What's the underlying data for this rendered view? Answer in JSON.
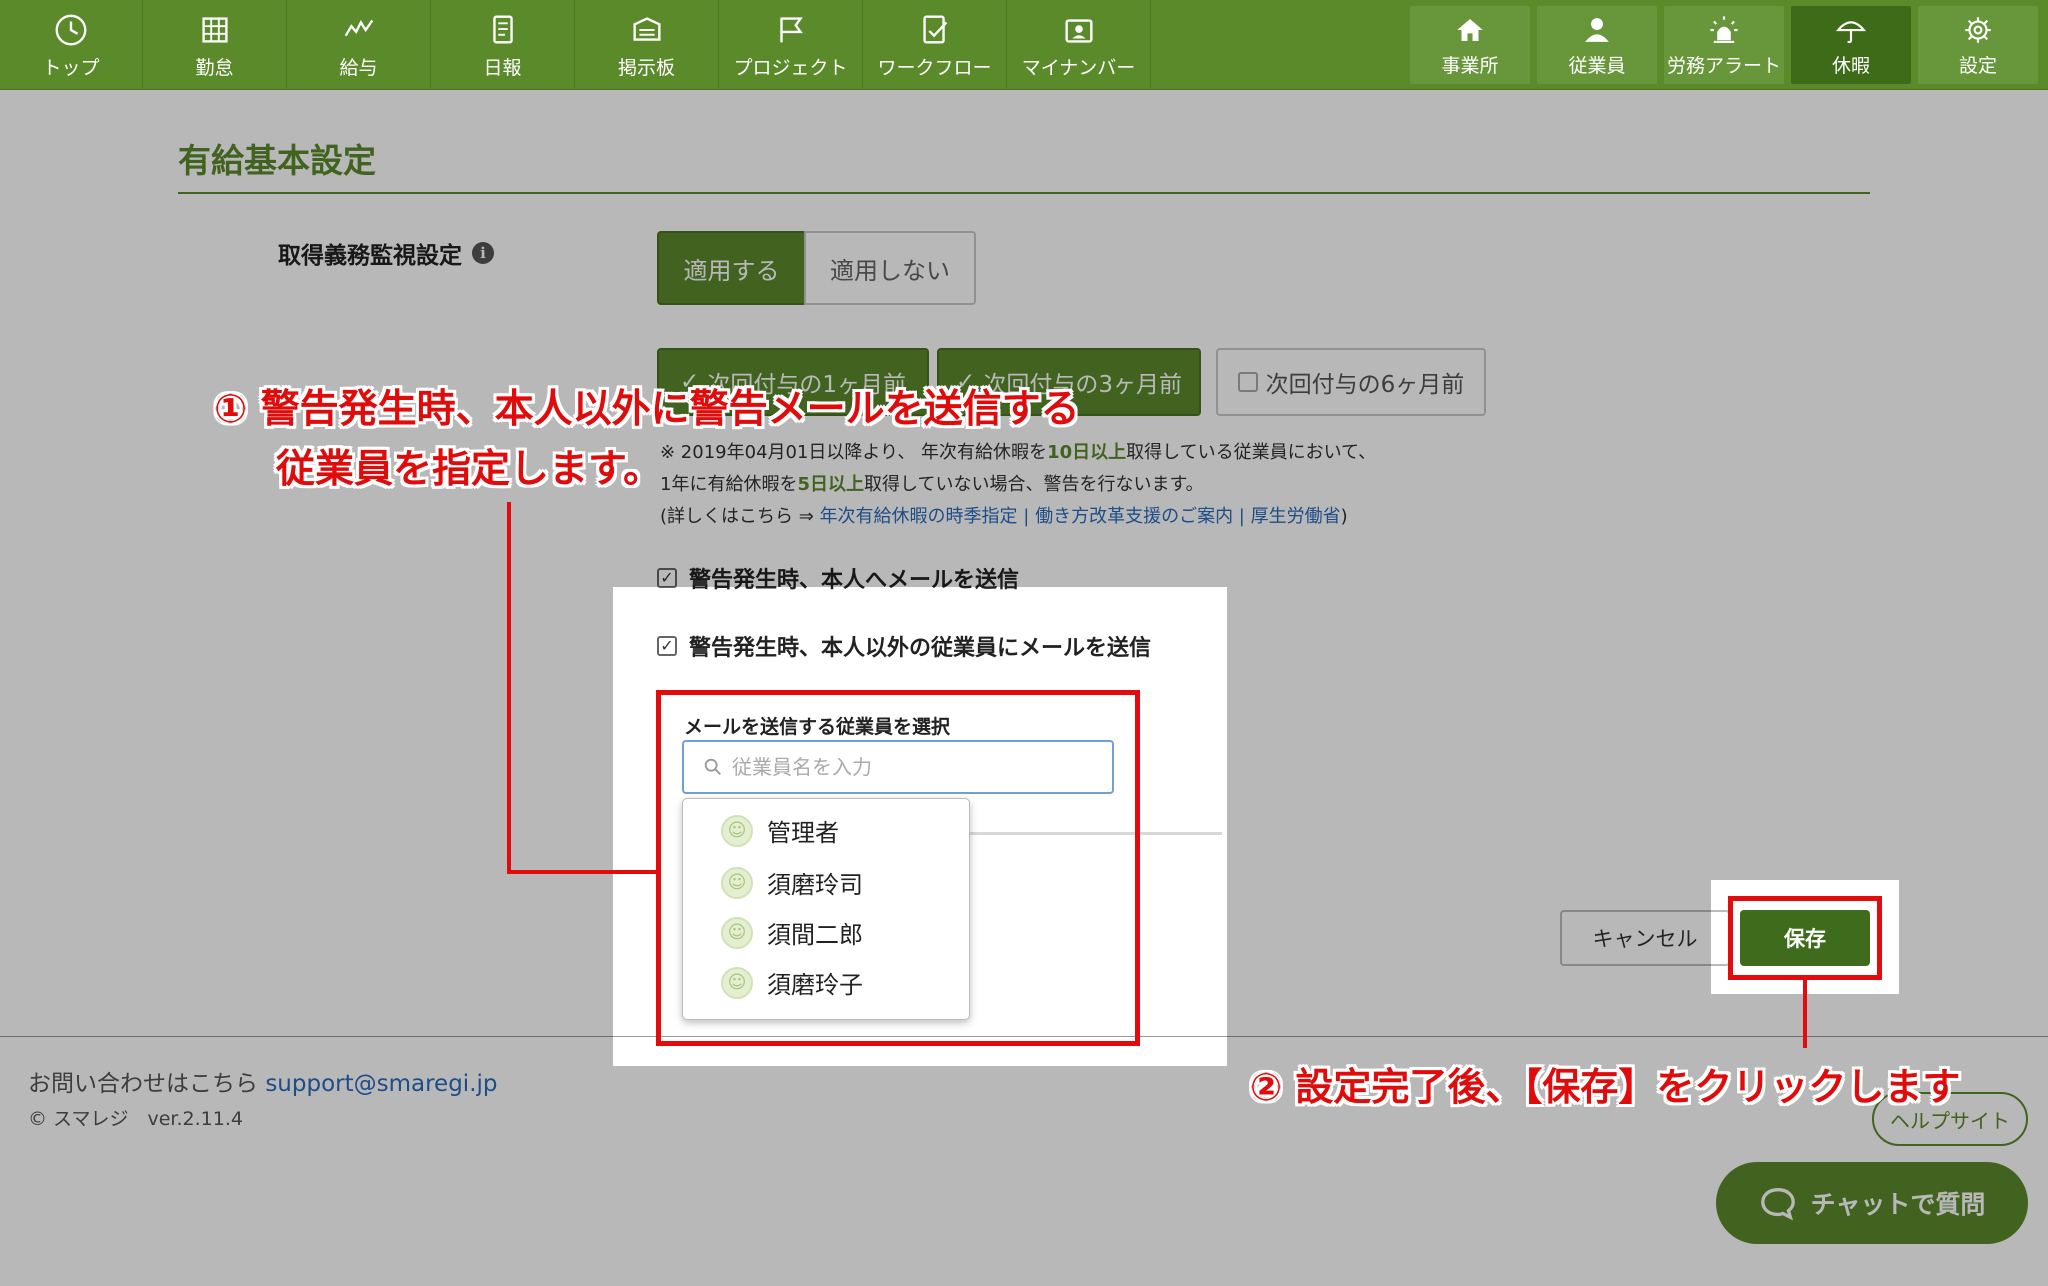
{
  "nav": {
    "left_items": [
      {
        "label": "トップ",
        "icon": "clock-icon"
      },
      {
        "label": "勤怠",
        "icon": "calendar-grid-icon"
      },
      {
        "label": "給与",
        "icon": "chart-line-icon"
      },
      {
        "label": "日報",
        "icon": "report-icon"
      },
      {
        "label": "掲示板",
        "icon": "board-icon"
      },
      {
        "label": "プロジェクト",
        "icon": "flag-icon"
      },
      {
        "label": "ワークフロー",
        "icon": "workflow-icon"
      },
      {
        "label": "マイナンバー",
        "icon": "id-card-icon"
      }
    ],
    "right_items": [
      {
        "label": "事業所",
        "icon": "home-icon"
      },
      {
        "label": "従業員",
        "icon": "person-icon"
      },
      {
        "label": "労務アラート",
        "icon": "alert-light-icon"
      },
      {
        "label": "休暇",
        "icon": "umbrella-icon"
      },
      {
        "label": "設定",
        "icon": "gear-icon"
      }
    ],
    "active": "休暇"
  },
  "page": {
    "title": "有給基本設定",
    "field_label": "取得義務監視設定",
    "info_icon": "i",
    "apply_on": "適用する",
    "apply_off": "適用しない",
    "options": [
      {
        "label": "次回付与の1ヶ月前",
        "checked": true
      },
      {
        "label": "次回付与の3ヶ月前",
        "checked": true
      },
      {
        "label": "次回付与の6ヶ月前",
        "checked": false
      }
    ],
    "note_line1_a": "※ 2019年04月01日以降より、 年次有給休暇を",
    "note_line1_hl": "10日以上",
    "note_line1_b": "取得している従業員において、",
    "note_line2_a": "1年に有給休暇を",
    "note_line2_hl": "5日以上",
    "note_line2_b": "取得していない場合、警告を行ないます。",
    "note_line3_a": "(詳しくはこちら ⇒ ",
    "note_line3_link": "年次有給休暇の時季指定 | 働き方改革支援のご案内 | 厚生労働省",
    "note_line3_b": ")",
    "check_self": "警告発生時、本人へメールを送信",
    "check_others": "警告発生時、本人以外の従業員にメールを送信",
    "select_title": "メールを送信する従業員を選択",
    "search_placeholder": "従業員名を入力",
    "employees": [
      "管理者",
      "須磨玲司",
      "須間二郎",
      "須磨玲子"
    ],
    "cancel": "キャンセル",
    "save": "保存"
  },
  "footer": {
    "contact": "お問い合わせはこちら",
    "email": "support@smaregi.jp",
    "copyright": "© スマレジ　ver.2.11.4",
    "help": "ヘルプサイト",
    "chat": "チャットで質問"
  },
  "annotations": {
    "step1_line1": "① 警告発生時、本人以外に警告メールを送信する",
    "step1_line2": "従業員を指定します。",
    "step2": "② 設定完了後、【保存】をクリックします",
    "color": "#e30b0b"
  },
  "colors": {
    "brand": "#5b8a2b",
    "save_button": "#3f6b1c",
    "link": "#2a6bbd"
  }
}
